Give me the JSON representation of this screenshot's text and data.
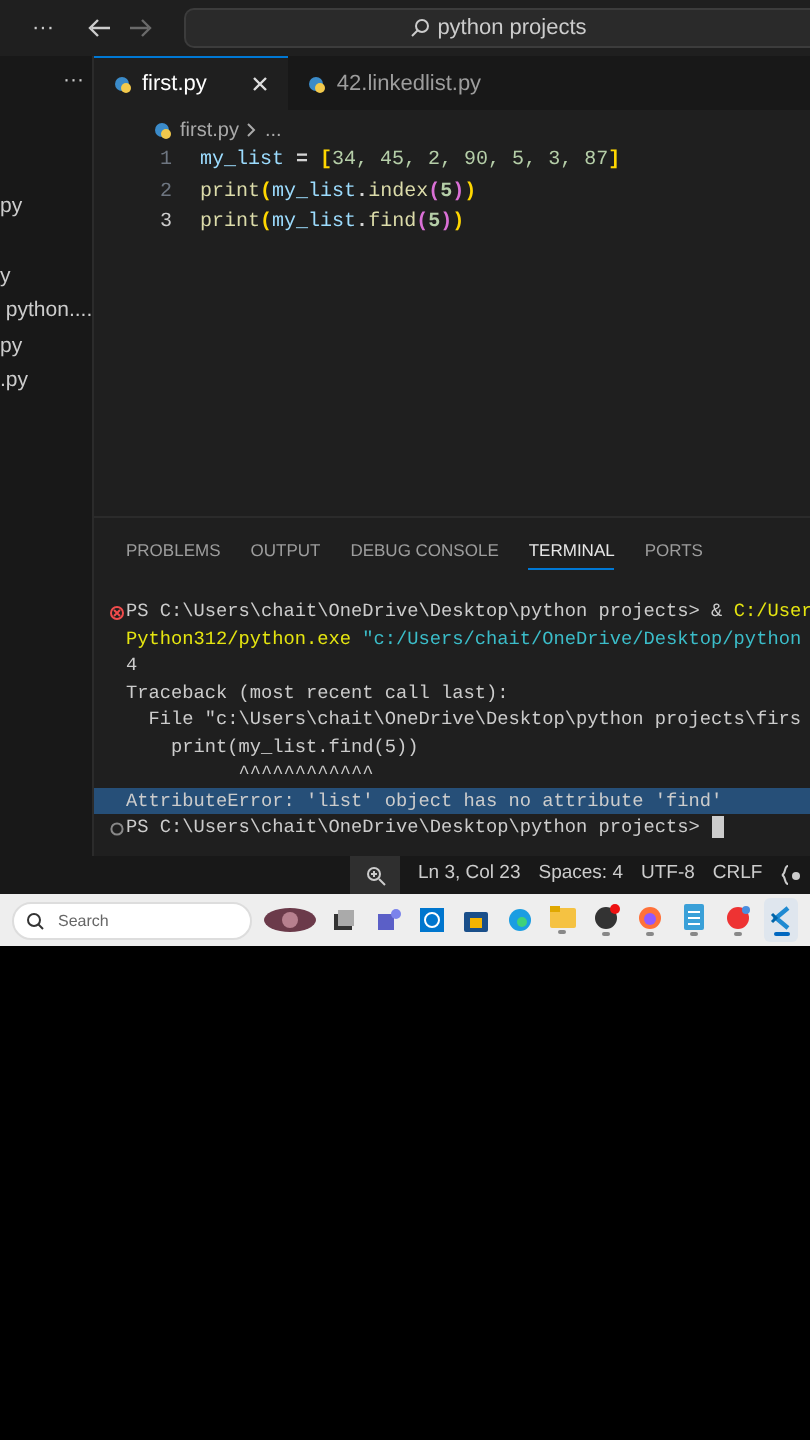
{
  "title_bar": {
    "menu": "···",
    "search": "python projects"
  },
  "sidebar": {
    "menu": "···",
    "items": [
      "py",
      "y",
      " python....",
      "py",
      ".py"
    ]
  },
  "tabs": [
    {
      "label": "first.py",
      "selected": true
    },
    {
      "label": "42.linkedlist.py",
      "selected": false
    }
  ],
  "breadcrumb": [
    "first.py",
    "..."
  ],
  "code_lines": [
    {
      "number": "1",
      "current": false,
      "tokens": [
        {
          "text": "my_list ",
          "color": "#9cdcfe"
        },
        {
          "text": "=",
          "color": "#d4d4d4"
        },
        {
          "text": " [",
          "color": "#ffd700"
        },
        {
          "text": "34, 45, 2, 90, 5, 3, 87",
          "color": "#b5cea8"
        },
        {
          "text": "]",
          "color": "#ffd700"
        }
      ]
    },
    {
      "number": "2",
      "current": false,
      "tokens": [
        {
          "text": "print",
          "color": "#dcdcaa"
        },
        {
          "text": "(",
          "color": "#ffd700"
        },
        {
          "text": "my_list",
          "color": "#9cdcfe"
        },
        {
          "text": ".",
          "color": "#d4d4d4"
        },
        {
          "text": "index",
          "color": "#dcdcaa"
        },
        {
          "text": "(",
          "color": "#da70d6"
        },
        {
          "text": "5",
          "color": "#b5cea8"
        },
        {
          "text": ")",
          "color": "#da70d6"
        },
        {
          "text": ")",
          "color": "#ffd700"
        }
      ]
    },
    {
      "number": "3",
      "current": true,
      "tokens": [
        {
          "text": "print",
          "color": "#dcdcaa"
        },
        {
          "text": "(",
          "color": "#ffd700"
        },
        {
          "text": "my_list",
          "color": "#9cdcfe"
        },
        {
          "text": ".",
          "color": "#d4d4d4"
        },
        {
          "text": "find",
          "color": "#dcdcaa"
        },
        {
          "text": "(",
          "color": "#da70d6"
        },
        {
          "text": "5",
          "color": "#b5cea8"
        },
        {
          "text": ")",
          "color": "#da70d6"
        },
        {
          "text": ")",
          "color": "#ffd700"
        }
      ]
    }
  ],
  "panel_tabs": [
    {
      "label": "PROBLEMS",
      "selected": false
    },
    {
      "label": "OUTPUT",
      "selected": false
    },
    {
      "label": "DEBUG CONSOLE",
      "selected": false
    },
    {
      "label": "TERMINAL",
      "selected": true
    },
    {
      "label": "PORTS",
      "selected": false
    }
  ],
  "terminal": [
    {
      "kind": "error",
      "highlighted": false,
      "segments": [
        {
          "text": "PS C:\\Users\\chait\\OneDrive\\Desktop\\python projects> & ",
          "color": "#cccccc"
        },
        {
          "text": "C:/User",
          "color": "#e5e510"
        }
      ]
    },
    {
      "kind": "output",
      "highlighted": false,
      "segments": [
        {
          "text": "Python312/python.exe ",
          "color": "#e5e510"
        },
        {
          "text": "\"c:/Users/chait/OneDrive/Desktop/python",
          "color": "#3bbdc9"
        }
      ]
    },
    {
      "kind": "output",
      "highlighted": false,
      "segments": [
        {
          "text": "4",
          "color": "#cccccc"
        }
      ]
    },
    {
      "kind": "output",
      "highlighted": false,
      "segments": [
        {
          "text": "Traceback (most recent call last):",
          "color": "#cccccc"
        }
      ]
    },
    {
      "kind": "output",
      "highlighted": false,
      "segments": [
        {
          "text": "  File \"c:\\Users\\chait\\OneDrive\\Desktop\\python projects\\firs",
          "color": "#cccccc"
        }
      ]
    },
    {
      "kind": "output",
      "highlighted": false,
      "segments": [
        {
          "text": "    print(my_list.find(5))",
          "color": "#cccccc"
        }
      ]
    },
    {
      "kind": "output",
      "highlighted": false,
      "segments": [
        {
          "text": "          ^^^^^^^^^^^^",
          "color": "#cccccc"
        }
      ]
    },
    {
      "kind": "output",
      "highlighted": true,
      "segments": [
        {
          "text": "AttributeError: 'list' object has no attribute 'find'",
          "color": "#cccccc"
        }
      ]
    },
    {
      "kind": "prompt",
      "highlighted": false,
      "cursor": true,
      "segments": [
        {
          "text": "PS C:\\Users\\chait\\OneDrive\\Desktop\\python projects> ",
          "color": "#cccccc"
        }
      ]
    }
  ],
  "status_bar": [
    "Ln 3, Col 23",
    "Spaces: 4",
    "UTF-8",
    "CRLF"
  ],
  "taskbar": {
    "search_placeholder": "Search",
    "apps": [
      {
        "kind": "picture",
        "running": false,
        "selected": false
      },
      {
        "kind": "taskview",
        "running": false,
        "selected": false
      },
      {
        "kind": "people",
        "running": false,
        "selected": false
      },
      {
        "kind": "logo",
        "running": false,
        "selected": false
      },
      {
        "kind": "bag",
        "running": false,
        "selected": false
      },
      {
        "kind": "browser",
        "running": false,
        "selected": false
      },
      {
        "kind": "folder",
        "running": true,
        "selected": false
      },
      {
        "kind": "badgeapp",
        "running": true,
        "selected": false
      },
      {
        "kind": "fox",
        "running": true,
        "selected": false
      },
      {
        "kind": "notepad",
        "running": true,
        "selected": false
      },
      {
        "kind": "office",
        "running": true,
        "selected": false
      },
      {
        "kind": "code",
        "running": true,
        "selected": true
      }
    ]
  }
}
